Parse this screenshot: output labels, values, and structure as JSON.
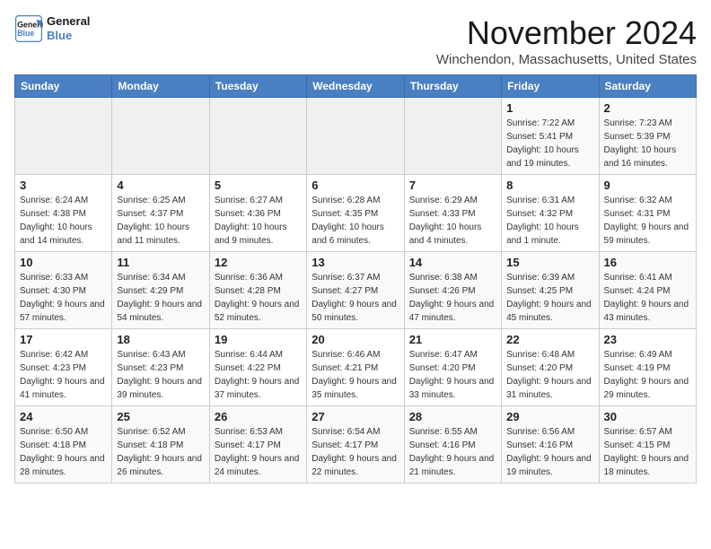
{
  "header": {
    "logo_line1": "General",
    "logo_line2": "Blue",
    "month_year": "November 2024",
    "location": "Winchendon, Massachusetts, United States"
  },
  "weekdays": [
    "Sunday",
    "Monday",
    "Tuesday",
    "Wednesday",
    "Thursday",
    "Friday",
    "Saturday"
  ],
  "weeks": [
    [
      {
        "day": "",
        "info": ""
      },
      {
        "day": "",
        "info": ""
      },
      {
        "day": "",
        "info": ""
      },
      {
        "day": "",
        "info": ""
      },
      {
        "day": "",
        "info": ""
      },
      {
        "day": "1",
        "info": "Sunrise: 7:22 AM\nSunset: 5:41 PM\nDaylight: 10 hours and 19 minutes."
      },
      {
        "day": "2",
        "info": "Sunrise: 7:23 AM\nSunset: 5:39 PM\nDaylight: 10 hours and 16 minutes."
      }
    ],
    [
      {
        "day": "3",
        "info": "Sunrise: 6:24 AM\nSunset: 4:38 PM\nDaylight: 10 hours and 14 minutes."
      },
      {
        "day": "4",
        "info": "Sunrise: 6:25 AM\nSunset: 4:37 PM\nDaylight: 10 hours and 11 minutes."
      },
      {
        "day": "5",
        "info": "Sunrise: 6:27 AM\nSunset: 4:36 PM\nDaylight: 10 hours and 9 minutes."
      },
      {
        "day": "6",
        "info": "Sunrise: 6:28 AM\nSunset: 4:35 PM\nDaylight: 10 hours and 6 minutes."
      },
      {
        "day": "7",
        "info": "Sunrise: 6:29 AM\nSunset: 4:33 PM\nDaylight: 10 hours and 4 minutes."
      },
      {
        "day": "8",
        "info": "Sunrise: 6:31 AM\nSunset: 4:32 PM\nDaylight: 10 hours and 1 minute."
      },
      {
        "day": "9",
        "info": "Sunrise: 6:32 AM\nSunset: 4:31 PM\nDaylight: 9 hours and 59 minutes."
      }
    ],
    [
      {
        "day": "10",
        "info": "Sunrise: 6:33 AM\nSunset: 4:30 PM\nDaylight: 9 hours and 57 minutes."
      },
      {
        "day": "11",
        "info": "Sunrise: 6:34 AM\nSunset: 4:29 PM\nDaylight: 9 hours and 54 minutes."
      },
      {
        "day": "12",
        "info": "Sunrise: 6:36 AM\nSunset: 4:28 PM\nDaylight: 9 hours and 52 minutes."
      },
      {
        "day": "13",
        "info": "Sunrise: 6:37 AM\nSunset: 4:27 PM\nDaylight: 9 hours and 50 minutes."
      },
      {
        "day": "14",
        "info": "Sunrise: 6:38 AM\nSunset: 4:26 PM\nDaylight: 9 hours and 47 minutes."
      },
      {
        "day": "15",
        "info": "Sunrise: 6:39 AM\nSunset: 4:25 PM\nDaylight: 9 hours and 45 minutes."
      },
      {
        "day": "16",
        "info": "Sunrise: 6:41 AM\nSunset: 4:24 PM\nDaylight: 9 hours and 43 minutes."
      }
    ],
    [
      {
        "day": "17",
        "info": "Sunrise: 6:42 AM\nSunset: 4:23 PM\nDaylight: 9 hours and 41 minutes."
      },
      {
        "day": "18",
        "info": "Sunrise: 6:43 AM\nSunset: 4:23 PM\nDaylight: 9 hours and 39 minutes."
      },
      {
        "day": "19",
        "info": "Sunrise: 6:44 AM\nSunset: 4:22 PM\nDaylight: 9 hours and 37 minutes."
      },
      {
        "day": "20",
        "info": "Sunrise: 6:46 AM\nSunset: 4:21 PM\nDaylight: 9 hours and 35 minutes."
      },
      {
        "day": "21",
        "info": "Sunrise: 6:47 AM\nSunset: 4:20 PM\nDaylight: 9 hours and 33 minutes."
      },
      {
        "day": "22",
        "info": "Sunrise: 6:48 AM\nSunset: 4:20 PM\nDaylight: 9 hours and 31 minutes."
      },
      {
        "day": "23",
        "info": "Sunrise: 6:49 AM\nSunset: 4:19 PM\nDaylight: 9 hours and 29 minutes."
      }
    ],
    [
      {
        "day": "24",
        "info": "Sunrise: 6:50 AM\nSunset: 4:18 PM\nDaylight: 9 hours and 28 minutes."
      },
      {
        "day": "25",
        "info": "Sunrise: 6:52 AM\nSunset: 4:18 PM\nDaylight: 9 hours and 26 minutes."
      },
      {
        "day": "26",
        "info": "Sunrise: 6:53 AM\nSunset: 4:17 PM\nDaylight: 9 hours and 24 minutes."
      },
      {
        "day": "27",
        "info": "Sunrise: 6:54 AM\nSunset: 4:17 PM\nDaylight: 9 hours and 22 minutes."
      },
      {
        "day": "28",
        "info": "Sunrise: 6:55 AM\nSunset: 4:16 PM\nDaylight: 9 hours and 21 minutes."
      },
      {
        "day": "29",
        "info": "Sunrise: 6:56 AM\nSunset: 4:16 PM\nDaylight: 9 hours and 19 minutes."
      },
      {
        "day": "30",
        "info": "Sunrise: 6:57 AM\nSunset: 4:15 PM\nDaylight: 9 hours and 18 minutes."
      }
    ]
  ]
}
